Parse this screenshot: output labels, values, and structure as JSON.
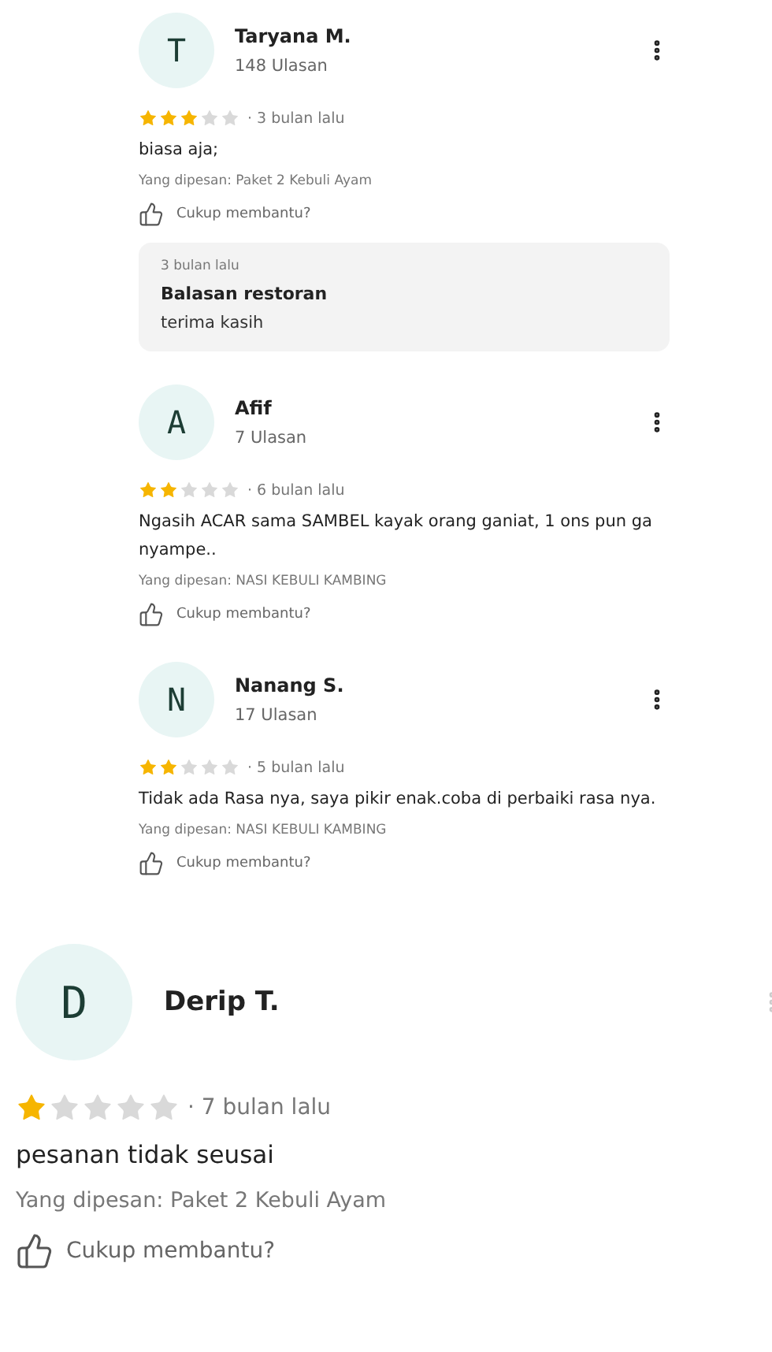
{
  "reviews": [
    {
      "kind": "compact",
      "initial": "T",
      "name": "Taryana M.",
      "review_count": "148 Ulasan",
      "stars": 3,
      "time": "· 3 bulan lalu",
      "text": "biasa aja;",
      "ordered": "Yang dipesan: Paket 2 Kebuli Ayam",
      "helpful": "Cukup membantu?",
      "reply": {
        "time": "3 bulan lalu",
        "title": "Balasan restoran",
        "text": "terima kasih"
      }
    },
    {
      "kind": "compact",
      "initial": "A",
      "name": "Afif",
      "review_count": "7 Ulasan",
      "stars": 2,
      "time": "· 6 bulan lalu",
      "text": "Ngasih ACAR sama SAMBEL kayak orang ganiat, 1 ons pun ga nyampe..",
      "ordered": "Yang dipesan: NASI KEBULI KAMBING",
      "helpful": "Cukup membantu?"
    },
    {
      "kind": "compact",
      "initial": "N",
      "name": "Nanang S.",
      "review_count": "17 Ulasan",
      "stars": 2,
      "time": "· 5 bulan lalu",
      "text": "Tidak ada Rasa nya, saya pikir enak.coba di perbaiki rasa nya.",
      "ordered": "Yang dipesan: NASI KEBULI KAMBING",
      "helpful": "Cukup membantu?"
    },
    {
      "kind": "large",
      "initial": "D",
      "name": "Derip T.",
      "stars": 1,
      "time": "· 7 bulan lalu",
      "text": "pesanan tidak seusai",
      "ordered": "Yang dipesan: Paket 2 Kebuli Ayam",
      "helpful": "Cukup membantu?"
    }
  ]
}
